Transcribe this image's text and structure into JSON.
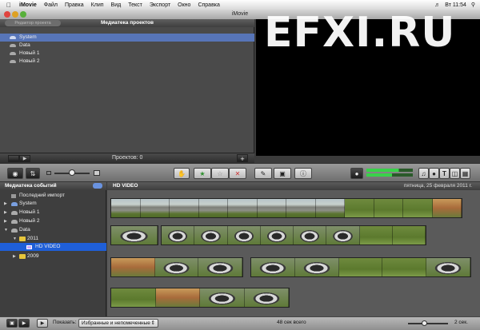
{
  "menubar": {
    "items": [
      "iMovie",
      "Файл",
      "Правка",
      "Клип",
      "Вид",
      "Текст",
      "Экспорт",
      "Окно",
      "Справка"
    ],
    "clock": "Вт 11:54"
  },
  "window": {
    "title": "iMovie"
  },
  "watermark": "EFXI.RU",
  "project_library": {
    "title": "Медиатека проектов",
    "back_button": "Редактор проекта",
    "items": [
      "System",
      "Data",
      "Новый 1",
      "Новый 2"
    ],
    "count_text": "Проектов: 0"
  },
  "event_library": {
    "title": "Медиатека событий",
    "items": [
      {
        "label": "Последний импорт"
      },
      {
        "label": "System"
      },
      {
        "label": "Новый 1"
      },
      {
        "label": "Новый 2"
      },
      {
        "label": "Data"
      },
      {
        "label": "2011"
      },
      {
        "label": "HD VIDEO"
      },
      {
        "label": "2009"
      }
    ]
  },
  "event_browser": {
    "title": "HD VIDEO",
    "date": "пятница, 25 февраля 2011 г."
  },
  "bottom_bar": {
    "show_label": "Показать:",
    "filter_value": "Избранные и непомеченные",
    "total": "48 сек всего",
    "duration": "2 сек."
  },
  "colors": {
    "selection": "#5775b8",
    "event_selection": "#1f5fd8",
    "audio_meter": "#39d14a"
  }
}
